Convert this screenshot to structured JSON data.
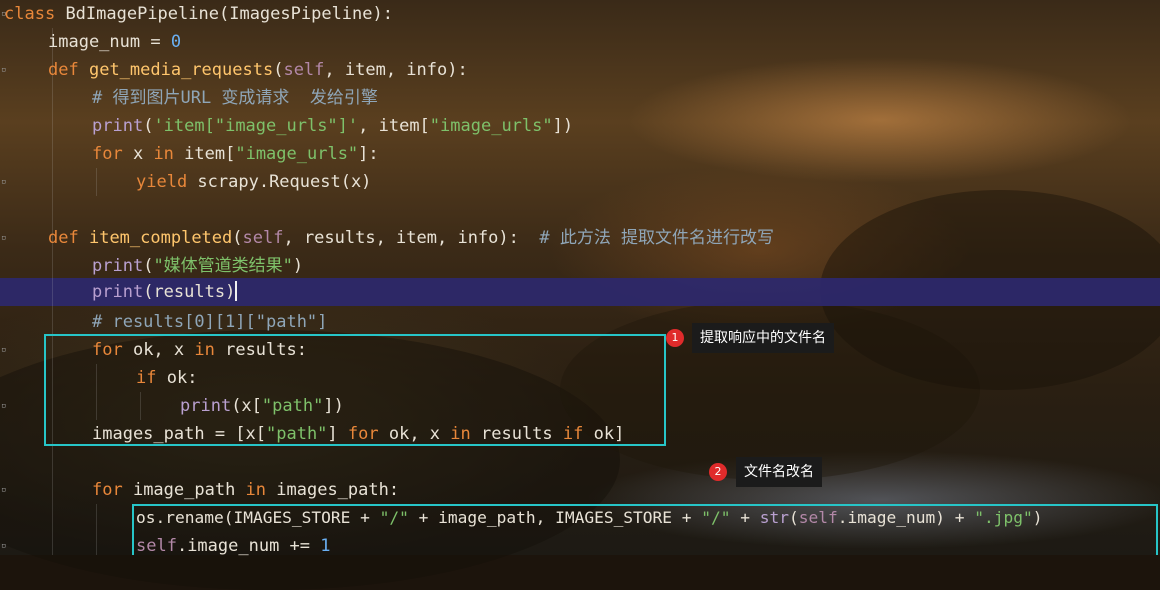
{
  "code": {
    "l1": {
      "kw": "class",
      "name": "BdImagePipeline",
      "paren": "(",
      "base": "ImagesPipeline",
      "end": "):"
    },
    "l2": {
      "name": "image_num",
      "op": " = ",
      "num": "0"
    },
    "l3": {
      "kw": "def",
      "fn": "get_media_requests",
      "p1": "(",
      "self": "self",
      "rest": ", item, info):"
    },
    "l4": {
      "comment": "# 得到图片URL 变成请求  发给引擎"
    },
    "l5": {
      "fn": "print",
      "p1": "(",
      "s1": "'item[\"image_urls\"]'",
      "mid": ", item[",
      "s2": "\"image_urls\"",
      "end": "])"
    },
    "l6": {
      "kw": "for",
      "a": " x ",
      "kw2": "in",
      "b": " item[",
      "s": "\"image_urls\"",
      "end": "]:"
    },
    "l7": {
      "kw": "yield",
      "rest": " scrapy.Request(x)"
    },
    "l9": {
      "kw": "def",
      "fn": "item_completed",
      "p1": "(",
      "self": "self",
      "rest": ", results, item, info):  ",
      "comment": "# 此方法 提取文件名进行改写"
    },
    "l10": {
      "fn": "print",
      "p1": "(",
      "s": "\"媒体管道类结果\"",
      "end": ")"
    },
    "l11": {
      "fn": "print",
      "p1": "(",
      "arg": "results",
      "end": ")"
    },
    "l12": {
      "comment": "# results[0][1][\"path\"]"
    },
    "l13": {
      "kw": "for",
      "a": " ok, x ",
      "kw2": "in",
      "b": " results:"
    },
    "l14": {
      "kw": "if",
      "a": " ok:"
    },
    "l15": {
      "fn": "print",
      "a": "(x[",
      "s": "\"path\"",
      "end": "])"
    },
    "l16": {
      "a": "images_path = [x[",
      "s": "\"path\"",
      "b": "] ",
      "kw": "for",
      "c": " ok, x ",
      "kw2": "in",
      "d": " results ",
      "kw3": "if",
      "e": " ok]"
    },
    "l18": {
      "kw": "for",
      "a": " image_path ",
      "kw2": "in",
      "b": " images_path:"
    },
    "l19": {
      "a": "os.rename(IMAGES_STORE + ",
      "s1": "\"/\"",
      "b": " + image_path, IMAGES_STORE + ",
      "s2": "\"/\"",
      "c": " + ",
      "bi": "str",
      "d": "(",
      "self": "self",
      "e": ".image_num) + ",
      "s3": "\".jpg\"",
      "f": ")"
    },
    "l20": {
      "self": "self",
      "a": ".image_num += ",
      "num": "1"
    }
  },
  "annotations": {
    "a1": {
      "badge": "1",
      "text": "提取响应中的文件名"
    },
    "a2": {
      "badge": "2",
      "text": "文件名改名"
    }
  },
  "colors": {
    "box": "#27c5c8",
    "badge": "#e02b2b",
    "highlight": "#2c286e"
  }
}
